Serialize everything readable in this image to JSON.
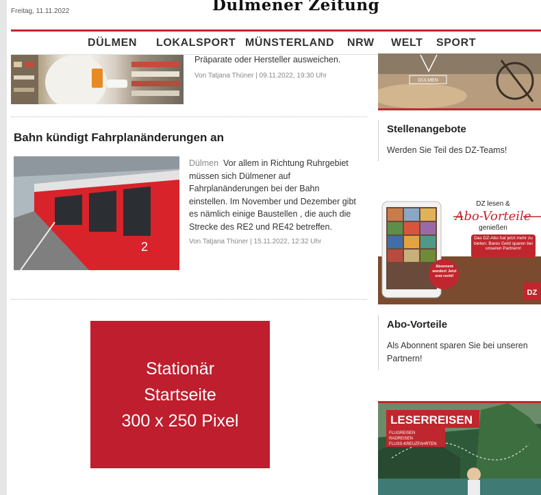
{
  "header": {
    "date": "Freitag, 11.11.2022",
    "logo": "Dülmener Zeitung"
  },
  "nav": {
    "items": [
      "DÜLMEN",
      "LOKALSPORT",
      "MÜNSTERLAND",
      "NRW",
      "WELT",
      "SPORT"
    ]
  },
  "article1": {
    "text_line": "Präparate oder Hersteller ausweichen.",
    "byline": "Von Tatjana Thüner  |  09.11.2022, 19:30 Uhr"
  },
  "article2": {
    "headline": "Bahn kündigt Fahrplanänderungen an",
    "location": "Dülmen",
    "lines": [
      "Vor allem in Richtung Ruhrgebiet",
      "müssen sich Dülmener auf",
      "Fahrplanänderungen bei der Bahn",
      "einstellen. Im November und Dezember gibt",
      "es nämlich einige Baustellen , die auch die",
      "Strecke des RE2 und RE42 betreffen."
    ],
    "byline": "Von Tatjana Thüner  |  15.11.2022, 12:32 Uhr",
    "platform_number": "2"
  },
  "ad": {
    "lines": [
      "Stationär",
      "Startseite",
      "300 x 250 Pixel"
    ]
  },
  "sidebar": {
    "image1_label": "DÜLMEN",
    "jobs": {
      "title": "Stellenangebote",
      "text": "Werden Sie Teil des DZ-Teams!"
    },
    "promo": {
      "line1": "DZ lesen &",
      "line2": "Abo-Vorteile",
      "line3": "genießen",
      "bubble": "Das DZ-Abo hat jetzt mehr zu bieten: Bares Geld sparen bei unseren Partnern!",
      "badge": "Abonnent werden! Jetzt erst recht!",
      "corner": "DZ"
    },
    "abo": {
      "title": "Abo-Vorteile",
      "text": "Als Abonnent sparen Sie bei unseren Partnern!"
    },
    "travel": {
      "title": "LESERREISEN",
      "items": [
        "FLUGREISEN",
        "RADREISEN",
        "FLUSS-KREUZFAHRTEN"
      ]
    }
  },
  "colors": {
    "accent_red": "#c0262d",
    "ad_red": "#be1e2d"
  }
}
